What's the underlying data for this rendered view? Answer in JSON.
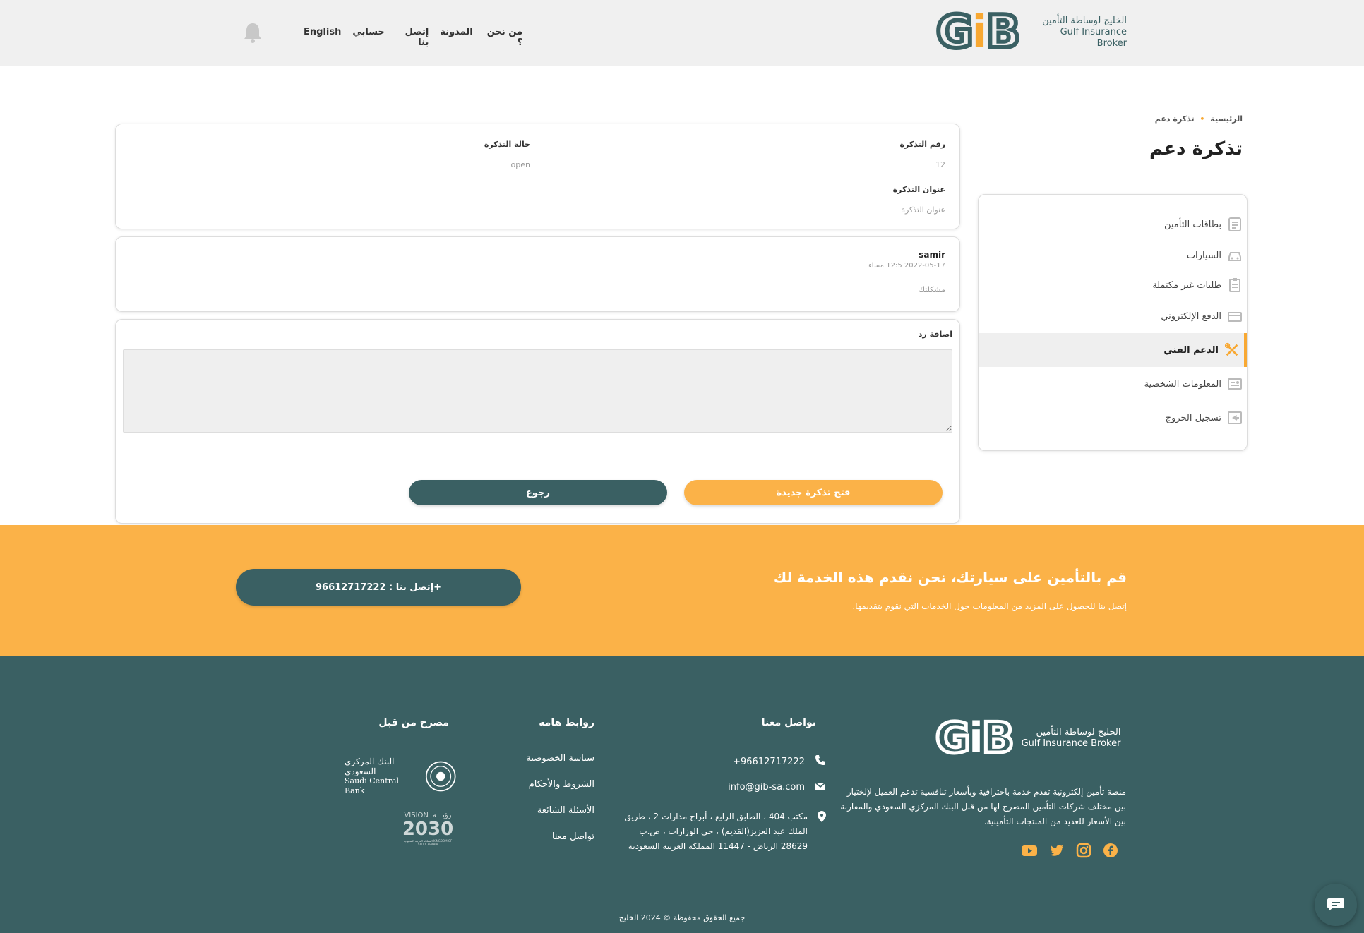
{
  "header": {
    "brand_ar": "الخليج لوساطة التأمين",
    "brand_en": "Gulf Insurance Broker",
    "nav": [
      "من نحن ؟",
      "المدونة",
      "إتصل بنا",
      "حسابي",
      "English"
    ],
    "notification_icon": "bell-icon"
  },
  "breadcrumb": {
    "home": "الرئيسية",
    "current": "تذكرة دعم"
  },
  "page_title": "تذكرة دعم",
  "sidebar": {
    "items": [
      {
        "label": "بطاقات التأمين",
        "icon": "card-icon"
      },
      {
        "label": "السيارات",
        "icon": "car-icon"
      },
      {
        "label": "طلبات غير مكتملة",
        "icon": "clipboard-icon"
      },
      {
        "label": "الدفع الإلكتروني",
        "icon": "payment-icon"
      },
      {
        "label": "الدعم الفني",
        "icon": "tools-icon",
        "active": true
      },
      {
        "label": "المعلومات الشخصية",
        "icon": "id-card-icon"
      },
      {
        "label": "تسجيل الخروج",
        "icon": "logout-icon"
      }
    ]
  },
  "ticket": {
    "number_label": "رقم التذكرة",
    "number_value": "12",
    "status_label": "حالة التذكرة",
    "status_value": "open",
    "subject_label": "عنوان التذكرة",
    "subject_value": "عنوان التذكرة"
  },
  "message": {
    "author": "samir",
    "timestamp": "2022-05-17 12:5 مساء",
    "text": "مشكلتك"
  },
  "reply": {
    "label": "اضافة رد",
    "textarea_value": "",
    "open_new_button": "فتح تذكرة جديدة",
    "back_button": "رجوع"
  },
  "cta": {
    "title": "قم بالتأمين على سيارتك، نحن نقدم هذه الخدمة لك",
    "subtitle": "إتصل بنا للحصول على المزيد من المعلومات حول الخدمات التي نقوم بتقديمها.",
    "button": "إتصل بنا : 96612717222+"
  },
  "footer": {
    "brand_ar": "الخليج لوساطة التأمين",
    "brand_en": "Gulf Insurance Broker",
    "about": "منصة تأمين إلكترونية تقدم خدمة باحترافية وبأسعار تنافسية تدعم العميل لإلختيار بين مختلف شركات التأمين المصرح لها من قبل البنك المركزي السعودي والمقارنة بين الأسعار للعديد من المنتجات التأمينية.",
    "social": [
      "facebook-icon",
      "instagram-icon",
      "twitter-icon",
      "youtube-icon"
    ],
    "contact_title": "تواصل معنا",
    "phone": "+96612717222",
    "email": "info@gib-sa.com",
    "address": "مكتب 404 ، الطابق الرابع ، أبراج مدارات 2 ، طريق الملك عبد العزيز(القديم) ، حي الوزارات ، ص.ب 28629 الرياض - 11447 المملكة العربية السعودية",
    "links_title": "روابط هامة",
    "links": [
      "سياسة الخصوصية",
      "الشروط والأحكام",
      "الأسئلة الشائعة",
      "تواصل معنا"
    ],
    "licensed_title": "مصرح من قبل",
    "sama_ar": "البنك المركزي السعودي",
    "sama_en": "Saudi Central Bank",
    "vision_ar": "رؤيـــة",
    "vision_en": "VISION",
    "vision_year": "2030",
    "vision_caption": "المملكة العربية السعودية KINGDOM OF SAUDI ARABIA",
    "copyright": "جميع الحقوق محفوظة © 2024 الخليج"
  },
  "colors": {
    "teal": "#3a6063",
    "orange": "#fbb248",
    "accent": "#f8a832"
  }
}
